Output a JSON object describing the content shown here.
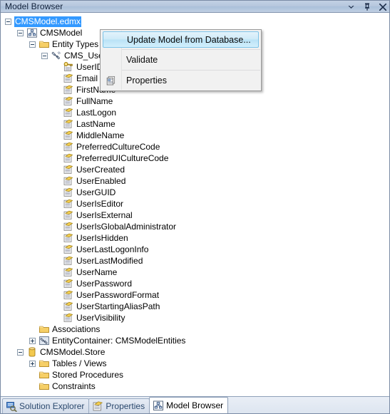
{
  "window": {
    "title": "Model Browser",
    "buttons": [
      {
        "name": "window-dropdown-button",
        "icon": "chevron-down-icon"
      },
      {
        "name": "auto-hide-pin-button",
        "icon": "pin-icon"
      },
      {
        "name": "close-button",
        "icon": "close-icon"
      }
    ]
  },
  "colors": {
    "selection_blue": "#3399ff",
    "titlebar_blue": "#b5c6dd",
    "folder_yellow": "#f8d775",
    "menu_highlight": "#cdeaf8"
  },
  "tree": {
    "nodes": [
      {
        "label": "CMSModel.edmx",
        "level": 0,
        "expander": "minus",
        "icon": "none",
        "selected": true
      },
      {
        "label": "CMSModel",
        "level": 1,
        "expander": "minus",
        "icon": "model-icon",
        "selected": false
      },
      {
        "label": "Entity Types",
        "level": 2,
        "expander": "minus",
        "icon": "folder-icon",
        "selected": false
      },
      {
        "label": "CMS_User",
        "level": 3,
        "expander": "minus",
        "icon": "entity-icon",
        "selected": false
      },
      {
        "label": "UserID",
        "level": 4,
        "expander": "none",
        "icon": "key-property-icon",
        "selected": false
      },
      {
        "label": "Email",
        "level": 4,
        "expander": "none",
        "icon": "property-icon",
        "selected": false
      },
      {
        "label": "FirstName",
        "level": 4,
        "expander": "none",
        "icon": "property-icon",
        "selected": false
      },
      {
        "label": "FullName",
        "level": 4,
        "expander": "none",
        "icon": "property-icon",
        "selected": false
      },
      {
        "label": "LastLogon",
        "level": 4,
        "expander": "none",
        "icon": "property-icon",
        "selected": false
      },
      {
        "label": "LastName",
        "level": 4,
        "expander": "none",
        "icon": "property-icon",
        "selected": false
      },
      {
        "label": "MiddleName",
        "level": 4,
        "expander": "none",
        "icon": "property-icon",
        "selected": false
      },
      {
        "label": "PreferredCultureCode",
        "level": 4,
        "expander": "none",
        "icon": "property-icon",
        "selected": false
      },
      {
        "label": "PreferredUICultureCode",
        "level": 4,
        "expander": "none",
        "icon": "property-icon",
        "selected": false
      },
      {
        "label": "UserCreated",
        "level": 4,
        "expander": "none",
        "icon": "property-icon",
        "selected": false
      },
      {
        "label": "UserEnabled",
        "level": 4,
        "expander": "none",
        "icon": "property-icon",
        "selected": false
      },
      {
        "label": "UserGUID",
        "level": 4,
        "expander": "none",
        "icon": "property-icon",
        "selected": false
      },
      {
        "label": "UserIsEditor",
        "level": 4,
        "expander": "none",
        "icon": "property-icon",
        "selected": false
      },
      {
        "label": "UserIsExternal",
        "level": 4,
        "expander": "none",
        "icon": "property-icon",
        "selected": false
      },
      {
        "label": "UserIsGlobalAdministrator",
        "level": 4,
        "expander": "none",
        "icon": "property-icon",
        "selected": false
      },
      {
        "label": "UserIsHidden",
        "level": 4,
        "expander": "none",
        "icon": "property-icon",
        "selected": false
      },
      {
        "label": "UserLastLogonInfo",
        "level": 4,
        "expander": "none",
        "icon": "property-icon",
        "selected": false
      },
      {
        "label": "UserLastModified",
        "level": 4,
        "expander": "none",
        "icon": "property-icon",
        "selected": false
      },
      {
        "label": "UserName",
        "level": 4,
        "expander": "none",
        "icon": "property-icon",
        "selected": false
      },
      {
        "label": "UserPassword",
        "level": 4,
        "expander": "none",
        "icon": "property-icon",
        "selected": false
      },
      {
        "label": "UserPasswordFormat",
        "level": 4,
        "expander": "none",
        "icon": "property-icon",
        "selected": false
      },
      {
        "label": "UserStartingAliasPath",
        "level": 4,
        "expander": "none",
        "icon": "property-icon",
        "selected": false
      },
      {
        "label": "UserVisibility",
        "level": 4,
        "expander": "none",
        "icon": "property-icon",
        "selected": false
      },
      {
        "label": "Associations",
        "level": 2,
        "expander": "none",
        "icon": "folder-icon",
        "selected": false
      },
      {
        "label": "EntityContainer: CMSModelEntities",
        "level": 2,
        "expander": "plus",
        "icon": "container-icon",
        "selected": false
      },
      {
        "label": "CMSModel.Store",
        "level": 1,
        "expander": "minus",
        "icon": "database-icon",
        "selected": false
      },
      {
        "label": "Tables / Views",
        "level": 2,
        "expander": "plus",
        "icon": "folder-icon",
        "selected": false
      },
      {
        "label": "Stored Procedures",
        "level": 2,
        "expander": "none",
        "icon": "folder-icon",
        "selected": false
      },
      {
        "label": "Constraints",
        "level": 2,
        "expander": "none",
        "icon": "folder-icon",
        "selected": false
      }
    ]
  },
  "context_menu": {
    "items": [
      {
        "label": "Update Model from Database...",
        "highlighted": true,
        "icon": "none",
        "separator_after": true
      },
      {
        "label": "Validate",
        "highlighted": false,
        "icon": "none",
        "separator_after": true
      },
      {
        "label": "Properties",
        "highlighted": false,
        "icon": "properties-icon",
        "separator_after": false
      }
    ]
  },
  "tabs": [
    {
      "label": "Solution Explorer",
      "icon": "solution-explorer-icon",
      "active": false
    },
    {
      "label": "Properties",
      "icon": "properties-icon",
      "active": false
    },
    {
      "label": "Model Browser",
      "icon": "model-browser-icon",
      "active": true
    }
  ]
}
